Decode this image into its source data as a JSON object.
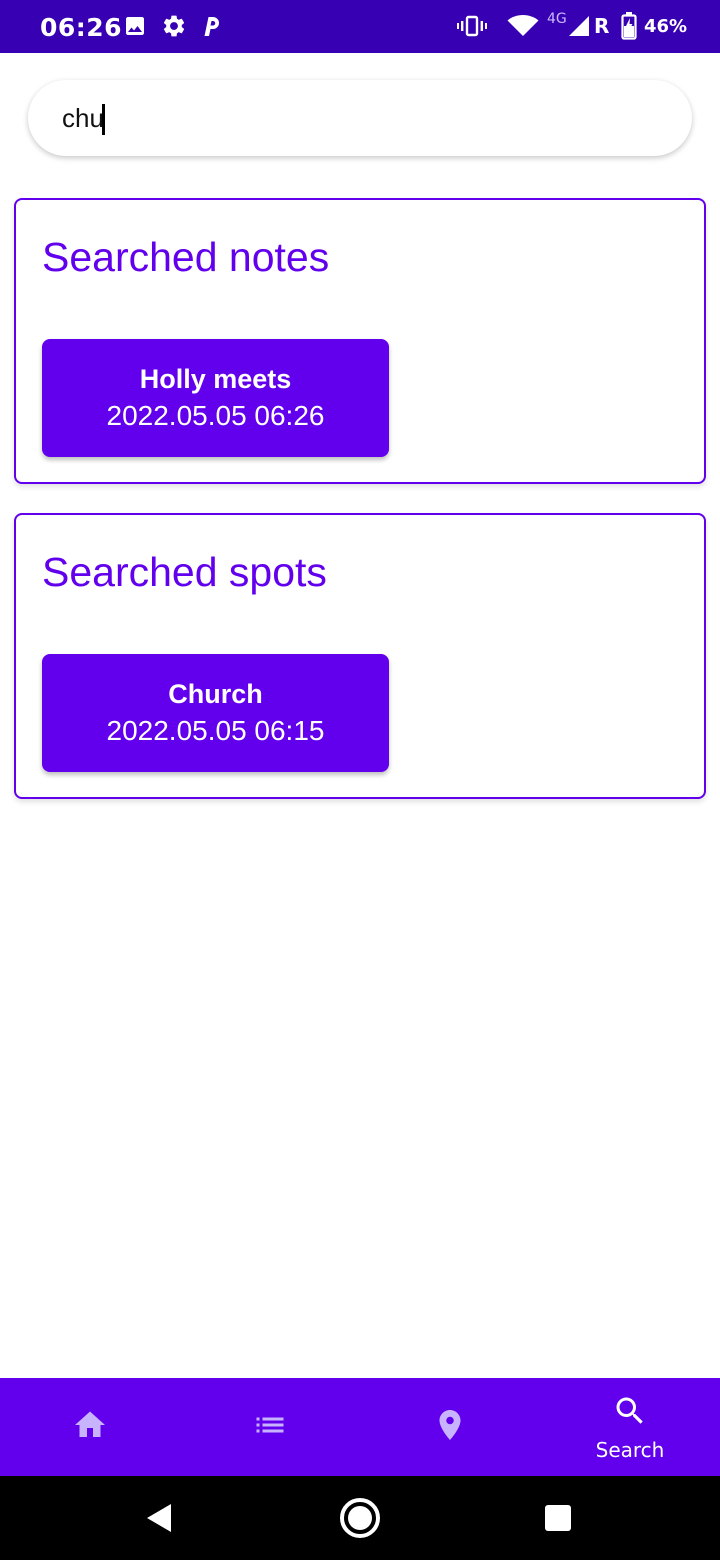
{
  "status_bar": {
    "time": "06:26",
    "left_icons": [
      "image-icon",
      "gear-icon",
      "parking-icon"
    ],
    "right_icons": [
      "vibrate-icon",
      "wifi-icon",
      "signal-icon",
      "battery-icon"
    ],
    "network_label": "4G",
    "roaming_label": "R",
    "battery": "46%"
  },
  "search": {
    "value": "chu",
    "placeholder": ""
  },
  "sections": [
    {
      "title": "Searched notes",
      "results": [
        {
          "title": "Holly meets",
          "date": "2022.05.05 06:26"
        }
      ]
    },
    {
      "title": "Searched spots",
      "results": [
        {
          "title": "Church",
          "date": "2022.05.05 06:15"
        }
      ]
    }
  ],
  "bottom_nav": {
    "items": [
      {
        "icon": "home-icon",
        "label": "",
        "active": false
      },
      {
        "icon": "list-icon",
        "label": "",
        "active": false
      },
      {
        "icon": "location-pin-icon",
        "label": "",
        "active": false
      },
      {
        "icon": "search-icon",
        "label": "Search",
        "active": true
      }
    ]
  },
  "system_nav": {
    "icons": [
      "back-icon",
      "home-circle-icon",
      "recents-icon"
    ]
  },
  "colors": {
    "status_bar": "#3700B3",
    "primary": "#6200EE",
    "nav_inactive_icon": "#c8b3ff",
    "background": "#ffffff"
  }
}
